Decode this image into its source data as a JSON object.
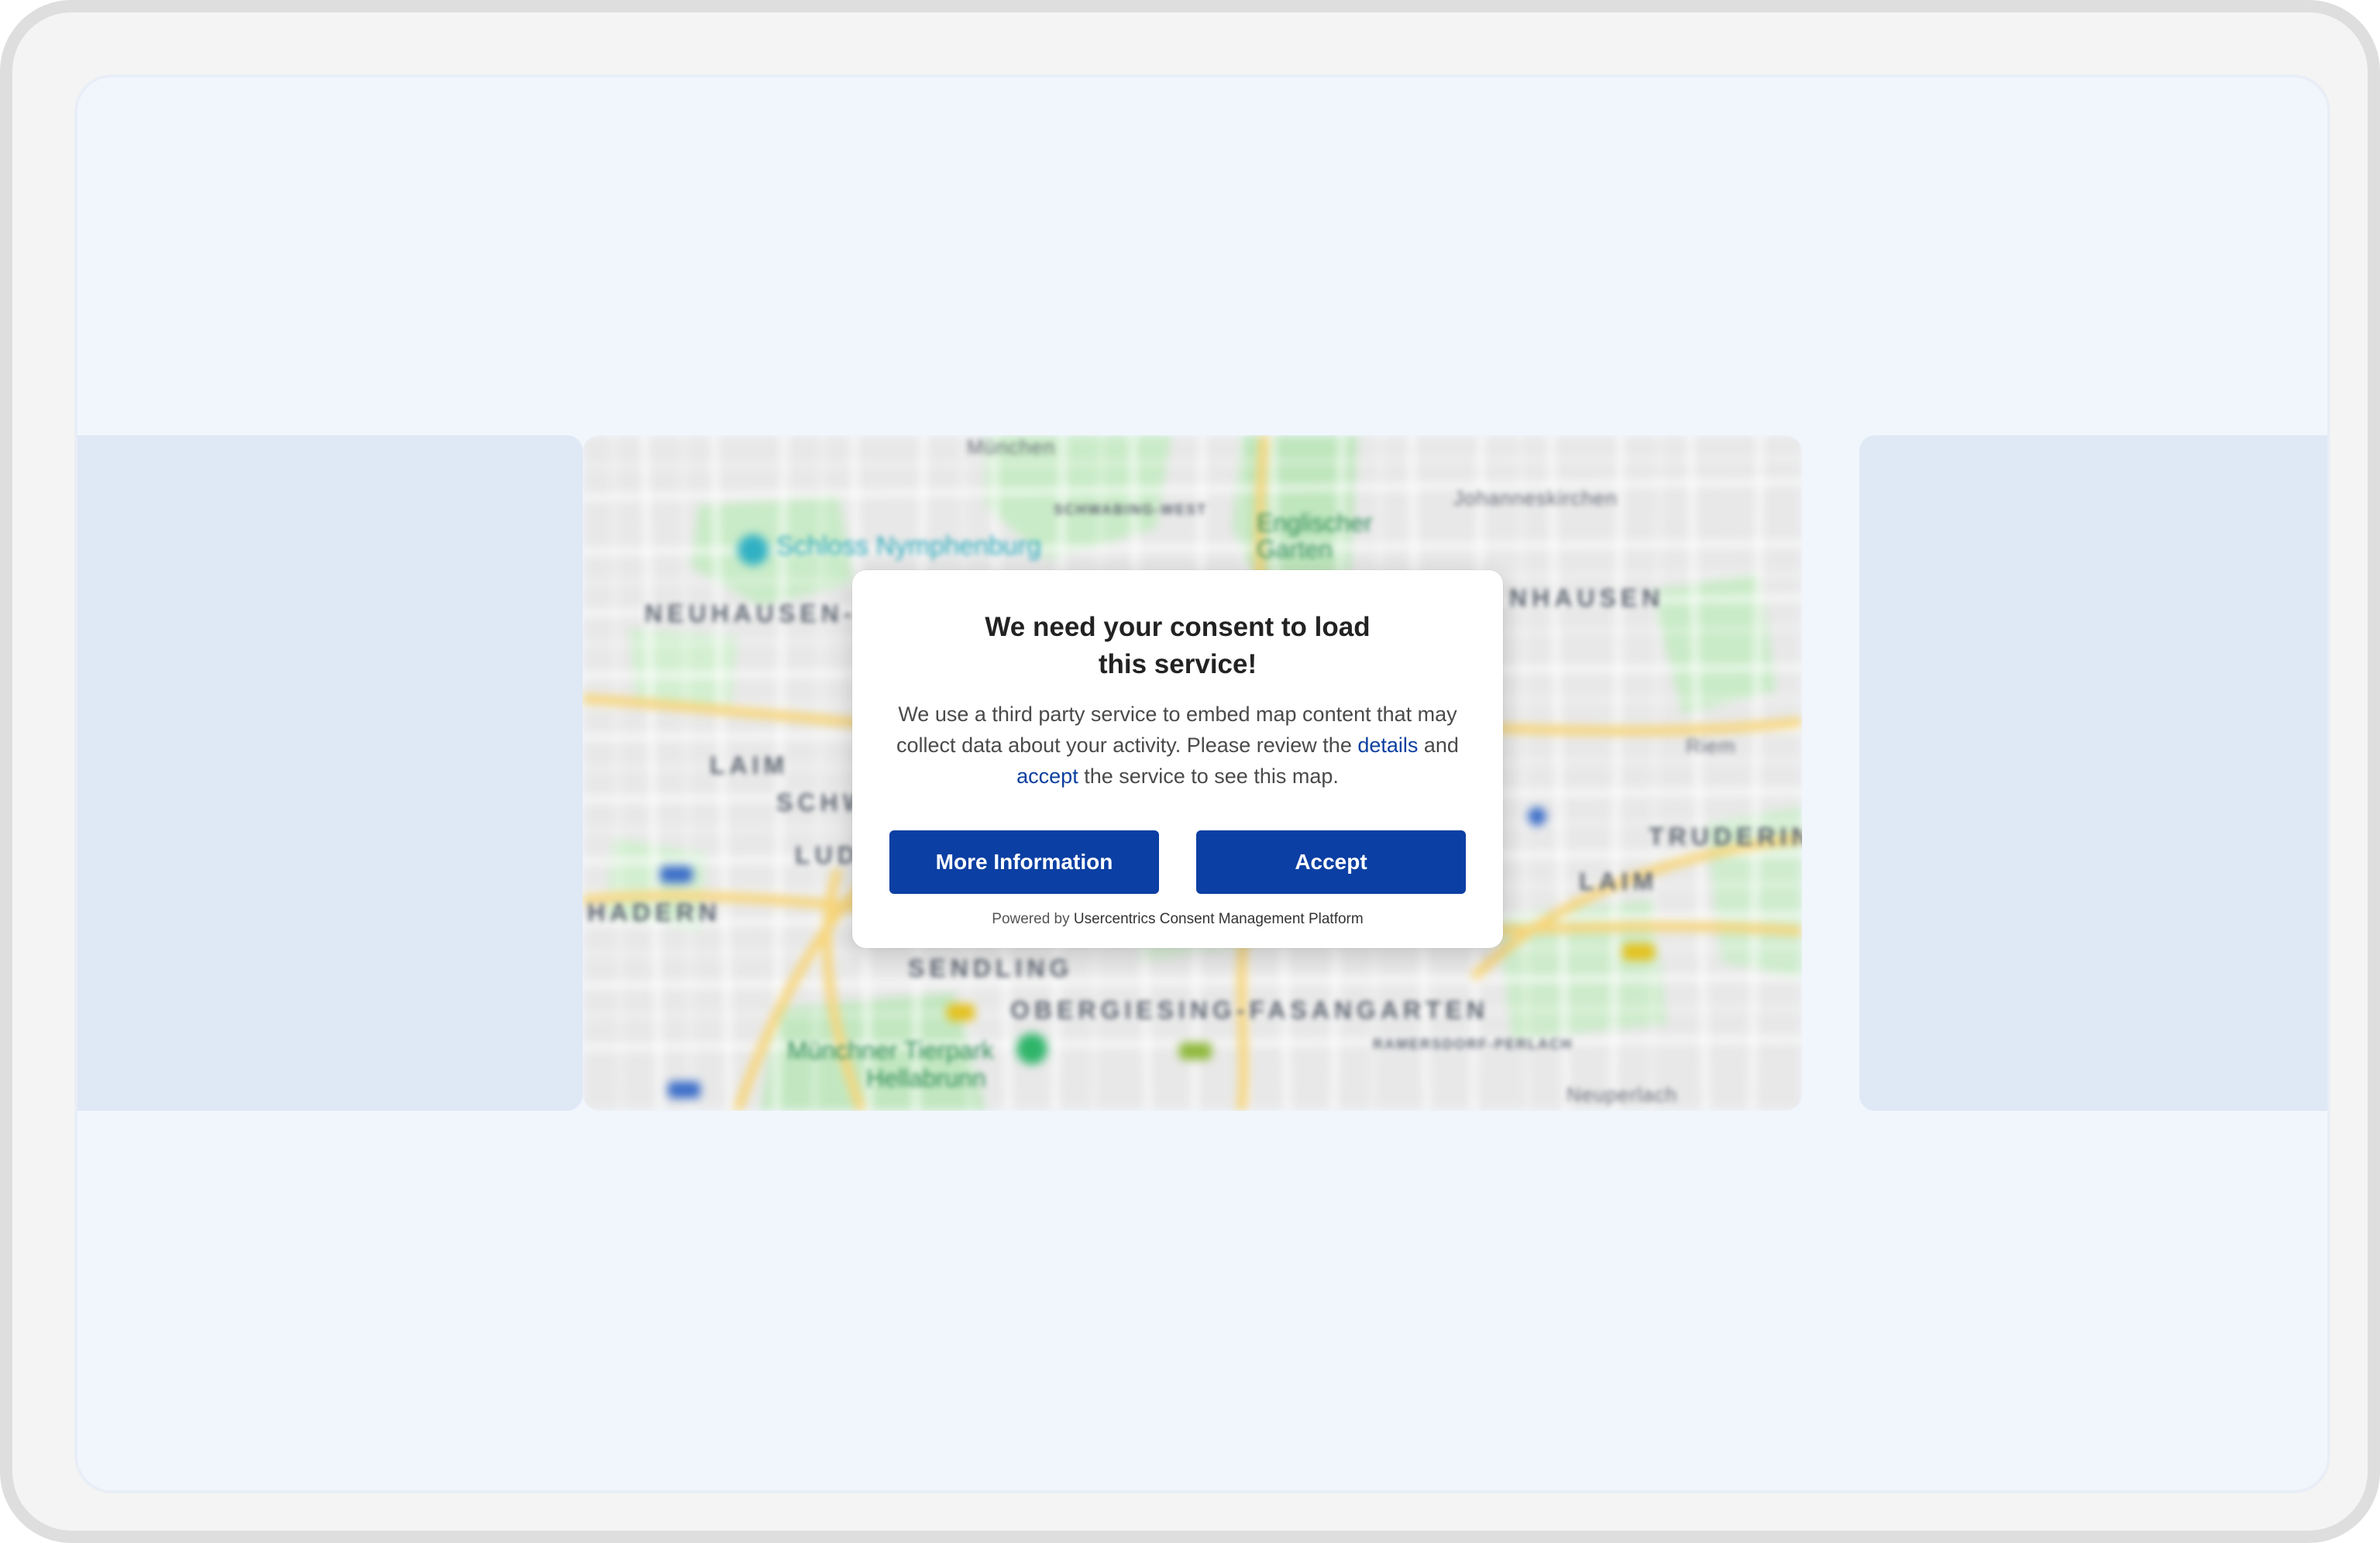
{
  "consent": {
    "title_line1": "We need your consent to load",
    "title_line2": "this service!",
    "body_part1": "We use a third party service to embed map content that may collect data about your activity. Please review the ",
    "details_link": "details",
    "body_part2": " and ",
    "accept_link": "accept",
    "body_part3": " the service to see this map.",
    "more_info_label": "More Information",
    "accept_label": "Accept",
    "powered_prefix": "Powered by ",
    "powered_brand": "Usercentrics Consent Management Platform"
  },
  "map": {
    "labels": {
      "muenchen": "München",
      "schwabing_west": "SCHWABING-WEST",
      "englischer_garten": "Englischer Garten",
      "johanneskirchen": "Johanneskirchen",
      "schloss": "Schloss Nymphenburg",
      "neuhausen": "NEUHAUSEN-N",
      "hausen": "NHAUSEN",
      "laim": "LAIM",
      "schw": "SCHW",
      "lud": "LUD",
      "hadern": "HADERN",
      "riem": "Riem",
      "trudering": "TRUDERING-RI",
      "laim_right": "LAIM",
      "sendling": "SENDLING",
      "obergiesing": "OBERGIESING-FASANGARTEN",
      "ramersdorf": "RAMERSDORF-PERLACH",
      "tierpark_1": "Münchner Tierpark",
      "tierpark_2": "Hellabrunn",
      "neuperlach": "Neuperlach"
    }
  },
  "colors": {
    "accent": "#0b3fa3",
    "link": "#0b3f9e",
    "screen_bg": "#f1f6fd",
    "side_card": "#dfe8f5"
  }
}
